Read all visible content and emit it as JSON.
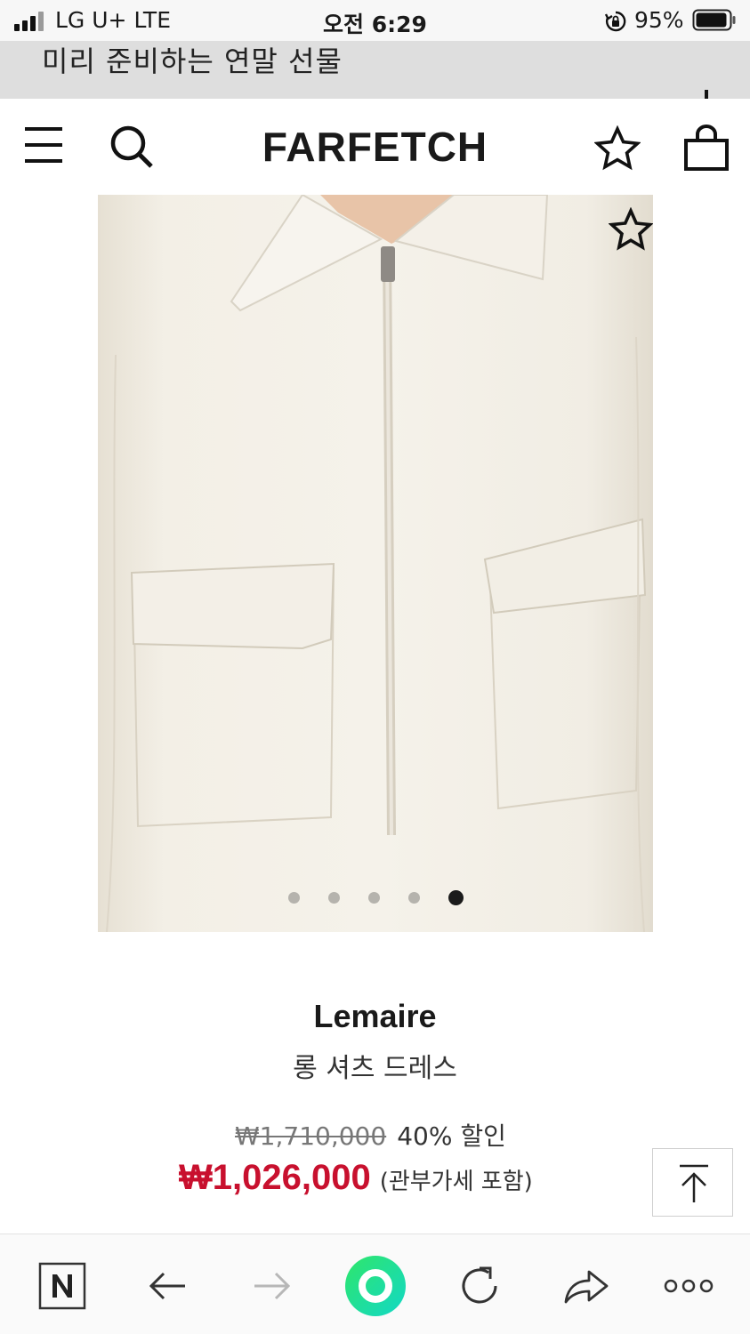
{
  "status_bar": {
    "carrier": "LG U+  LTE",
    "time": "오전 6:29",
    "battery": "95%",
    "icons": [
      "signal-icon",
      "rotation-lock-icon",
      "battery-icon"
    ]
  },
  "banner": {
    "text": "미리 준비하는 연말 선물",
    "expand_icon": "plus-icon"
  },
  "header": {
    "logo": "FARFETCH",
    "icons": [
      "hamburger-menu-icon",
      "search-icon",
      "star-icon",
      "shopping-bag-icon"
    ]
  },
  "gallery": {
    "image": "cream zip-front shirt with two flap chest pockets",
    "slide_count": 5,
    "active_slide": 5,
    "wishlist_icon": "star-icon"
  },
  "product": {
    "brand": "Lemaire",
    "name": "롱 셔츠 드레스",
    "original_price": "₩1,710,000",
    "discount": "40% 할인",
    "sale_price": "₩1,026,000",
    "tax_note": "(관부가세 포함)"
  },
  "scroll_top_icon": "arrow-up-to-top-icon",
  "browser_bar": {
    "icons": [
      "naver-icon",
      "back-arrow-icon",
      "forward-arrow-icon",
      "green-dot-icon",
      "reload-icon",
      "share-icon",
      "more-icon"
    ]
  },
  "colors": {
    "sale_red": "#c8102e",
    "image_bg": "#efeadf",
    "banner_bg": "#dedede",
    "green_button": "#1fe0a0"
  }
}
